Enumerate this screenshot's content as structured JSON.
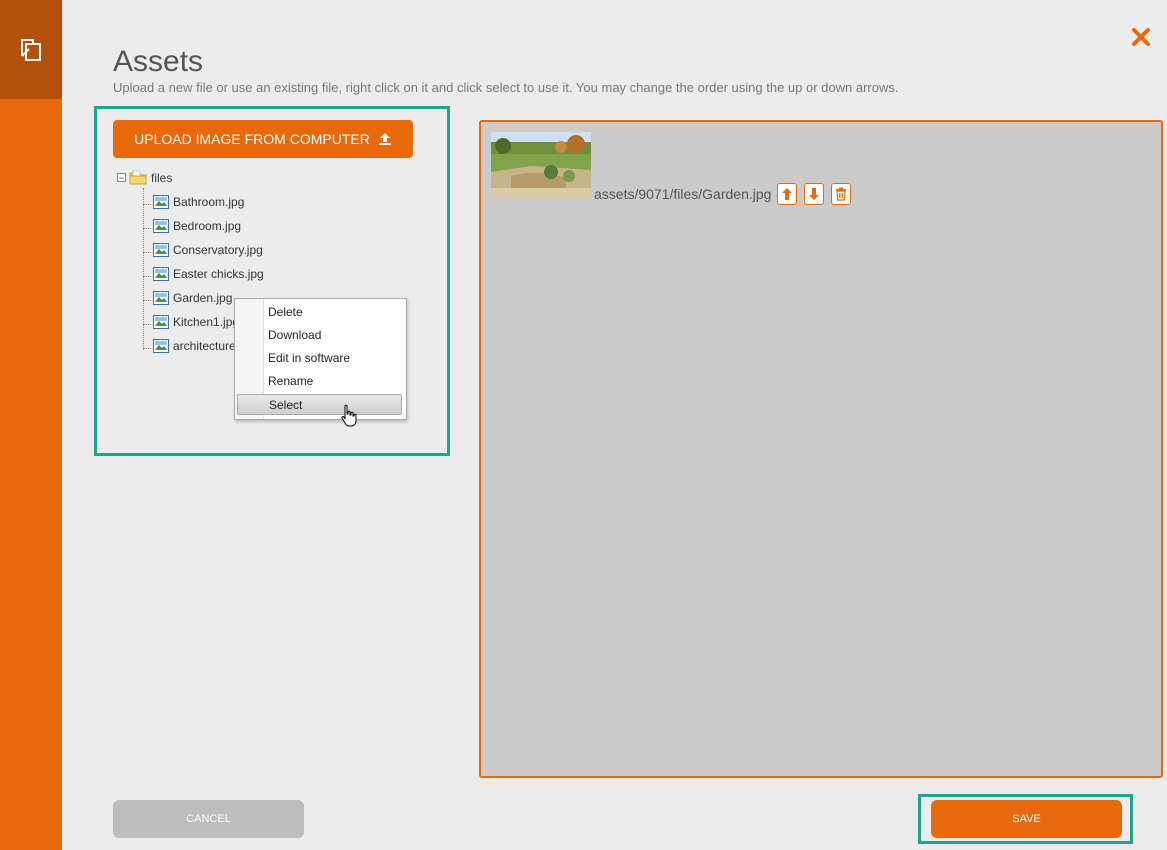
{
  "header": {
    "title": "Assets",
    "subtitle": "Upload a new file or use an existing file, right click on it and click select to use it. You may change the order using the up or down arrows."
  },
  "sidebar": {
    "icon": "copy-pages-icon"
  },
  "upload": {
    "label": "UPLOAD IMAGE FROM COMPUTER",
    "icon": "upload-icon"
  },
  "tree": {
    "root": "files",
    "items": [
      {
        "label": "Bathroom.jpg"
      },
      {
        "label": "Bedroom.jpg"
      },
      {
        "label": "Conservatory.jpg"
      },
      {
        "label": "Easter chicks.jpg"
      },
      {
        "label": "Garden.jpg"
      },
      {
        "label": "Kitchen1.jpg"
      },
      {
        "label": "architecture"
      }
    ]
  },
  "context_menu": {
    "items": [
      {
        "label": "Delete"
      },
      {
        "label": "Download"
      },
      {
        "label": "Edit in software"
      },
      {
        "label": "Rename"
      },
      {
        "label": "Select"
      }
    ],
    "highlighted": "Select"
  },
  "selected_assets": [
    {
      "path": "assets/9071/files/Garden.jpg"
    }
  ],
  "footer": {
    "cancel_label": "CANCEL",
    "save_label": "SAVE"
  },
  "colors": {
    "accent": "#e8690c",
    "accent_dark": "#b3500d",
    "highlight": "#1fa58c",
    "panel_bg": "#cbcbcb"
  }
}
